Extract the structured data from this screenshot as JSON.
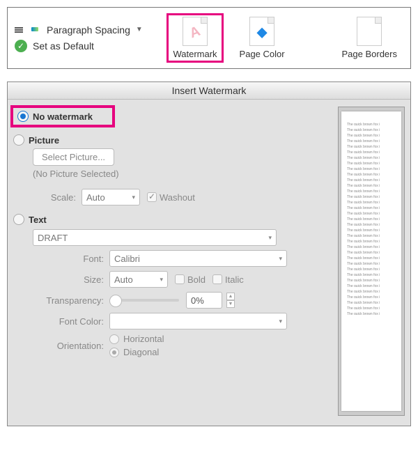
{
  "ribbon": {
    "paragraph_spacing": "Paragraph Spacing",
    "set_default": "Set as Default",
    "watermark": "Watermark",
    "page_color": "Page Color",
    "page_borders": "Page Borders"
  },
  "dialog": {
    "title": "Insert Watermark",
    "options": {
      "no_watermark": "No watermark",
      "picture": "Picture",
      "text": "Text"
    },
    "picture": {
      "select_btn": "Select Picture...",
      "no_selected": "(No Picture Selected)",
      "scale_label": "Scale:",
      "scale_value": "Auto",
      "washout": "Washout"
    },
    "text": {
      "value": "DRAFT",
      "font_label": "Font:",
      "font_value": "Calibri",
      "size_label": "Size:",
      "size_value": "Auto",
      "bold": "Bold",
      "italic": "Italic",
      "transparency_label": "Transparency:",
      "transparency_value": "0%",
      "font_color_label": "Font Color:",
      "orientation_label": "Orientation:",
      "horizontal": "Horizontal",
      "diagonal": "Diagonal"
    },
    "preview_line": "The quick brown fox j"
  }
}
